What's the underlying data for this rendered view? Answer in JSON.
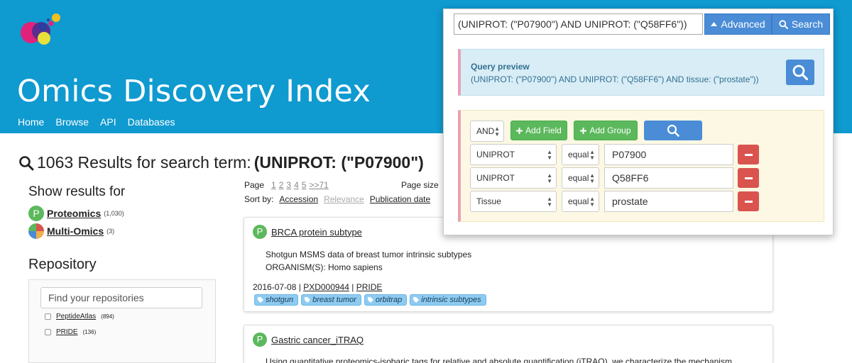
{
  "header": {
    "title": "Omics Discovery Index",
    "nav": [
      "Home",
      "Browse",
      "API",
      "Databases"
    ],
    "colors": {
      "bg": "#0f9ad0"
    }
  },
  "results": {
    "count_text": "1063 Results for search term:",
    "term": "(UNIPROT: (\"P07900\")"
  },
  "filters": {
    "show_results_title": "Show results for",
    "omics": [
      {
        "name": "Proteomics",
        "count": "(1,030)"
      },
      {
        "name": "Multi-Omics",
        "count": "(3)"
      }
    ],
    "repository_title": "Repository",
    "repository_placeholder": "Find your repositories",
    "repositories": [
      {
        "name": "PeptideAtlas",
        "count": "(894)"
      },
      {
        "name": "PRIDE",
        "count": "(136)"
      }
    ]
  },
  "pager": {
    "label": "Page",
    "pages": [
      "1",
      "2",
      "3",
      "4",
      "5",
      ">>71"
    ],
    "page_size_label": "Page size"
  },
  "sort": {
    "label": "Sort by:",
    "options": [
      "Accession",
      "Relevance",
      "Publication date"
    ]
  },
  "cards": [
    {
      "badge": "P",
      "title": "BRCA protein subtype",
      "desc_line1": "Shotgun MSMS data of breast tumor intrinsic subtypes",
      "desc_line2": "ORGANISM(S): Homo sapiens",
      "date": "2016-07-08",
      "accession": "PXD000944",
      "repo": "PRIDE",
      "tags": [
        "shotgun",
        "breast tumor",
        "orbitrap",
        "intrinsic subtypes"
      ]
    },
    {
      "badge": "P",
      "title": "Gastric cancer_iTRAQ",
      "desc_line1": "Using quantitative proteomics-isobaric tags for relative and absolute quantification (iTRAQ), we characterize the mechanism"
    }
  ],
  "advanced": {
    "query": "(UNIPROT: (\"P07900\") AND UNIPROT: (\"Q58FF6\"))",
    "advanced_label": "Advanced",
    "search_label": "Search",
    "preview_title": "Query preview",
    "preview_text": "(UNIPROT: (\"P07900\") AND UNIPROT: (\"Q58FF6\") AND tissue: (\"prostate\"))",
    "operator": "AND",
    "add_field_label": "Add Field",
    "add_group_label": "Add Group",
    "rules": [
      {
        "field": "UNIPROT",
        "op": "equal",
        "value": "P07900"
      },
      {
        "field": "UNIPROT",
        "op": "equal",
        "value": "Q58FF6"
      },
      {
        "field": "Tissue",
        "op": "equal",
        "value": "prostate"
      }
    ]
  }
}
